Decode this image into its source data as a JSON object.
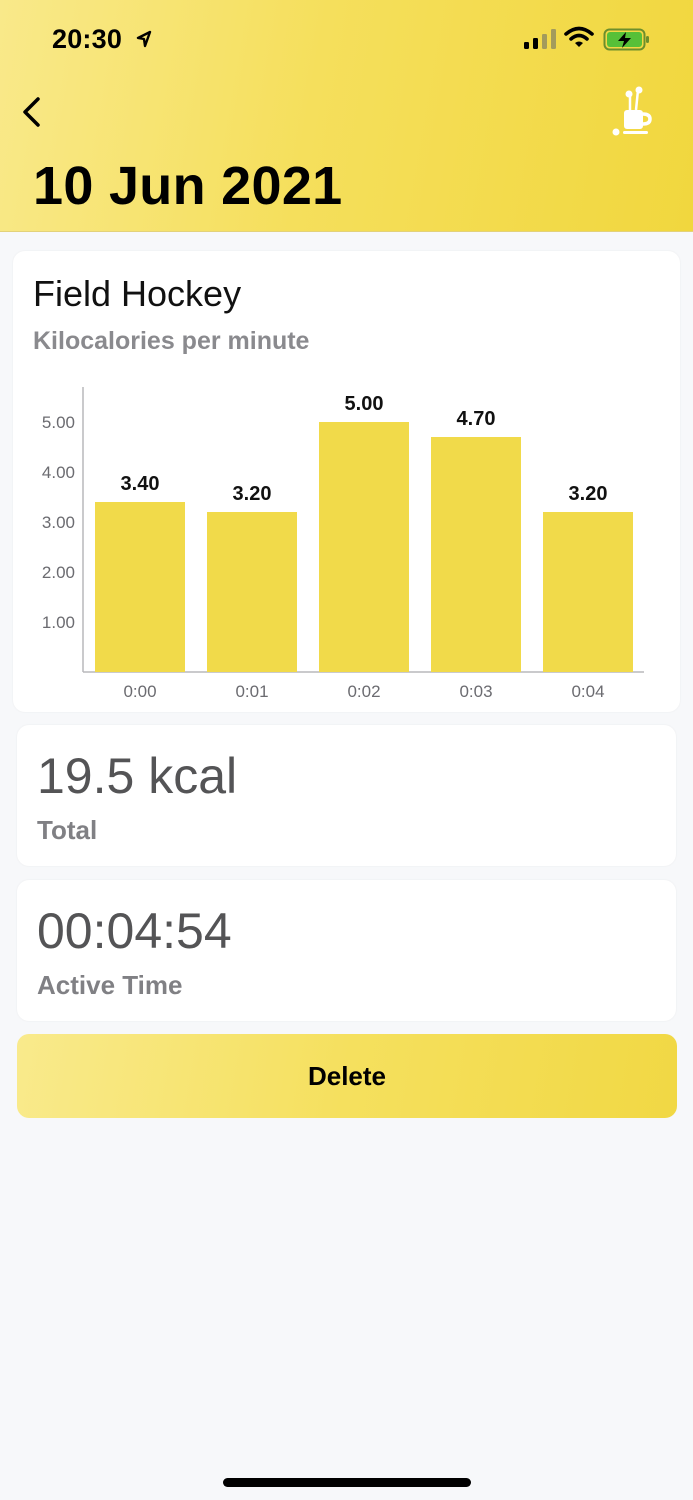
{
  "status_bar": {
    "time": "20:30"
  },
  "header": {
    "title": "10 Jun 2021",
    "back_icon": "chevron-left-icon",
    "activity_icon": "golf-bag-icon"
  },
  "chart_card": {
    "title": "Field Hockey",
    "subtitle": "Kilocalories per minute"
  },
  "chart_data": {
    "type": "bar",
    "title": "Field Hockey",
    "subtitle": "Kilocalories per minute",
    "categories": [
      "0:00",
      "0:01",
      "0:02",
      "0:03",
      "0:04"
    ],
    "values": [
      3.4,
      3.2,
      5.0,
      4.7,
      3.2
    ],
    "value_labels": [
      "3.40",
      "3.20",
      "5.00",
      "4.70",
      "3.20"
    ],
    "y_ticks": [
      "1.00",
      "2.00",
      "3.00",
      "4.00",
      "5.00"
    ],
    "ylim": [
      0,
      5.75
    ],
    "bar_color": "#f1da4a",
    "grid": false
  },
  "kcal_card": {
    "value": "19.5 kcal",
    "label": "Total"
  },
  "time_card": {
    "value": "00:04:54",
    "label": "Active Time"
  },
  "delete_button": {
    "label": "Delete"
  },
  "colors": {
    "accent": "#f1d73e",
    "accent_light": "#f9e98a",
    "background": "#f7f8fa",
    "label_gray": "#8a8a8e"
  }
}
